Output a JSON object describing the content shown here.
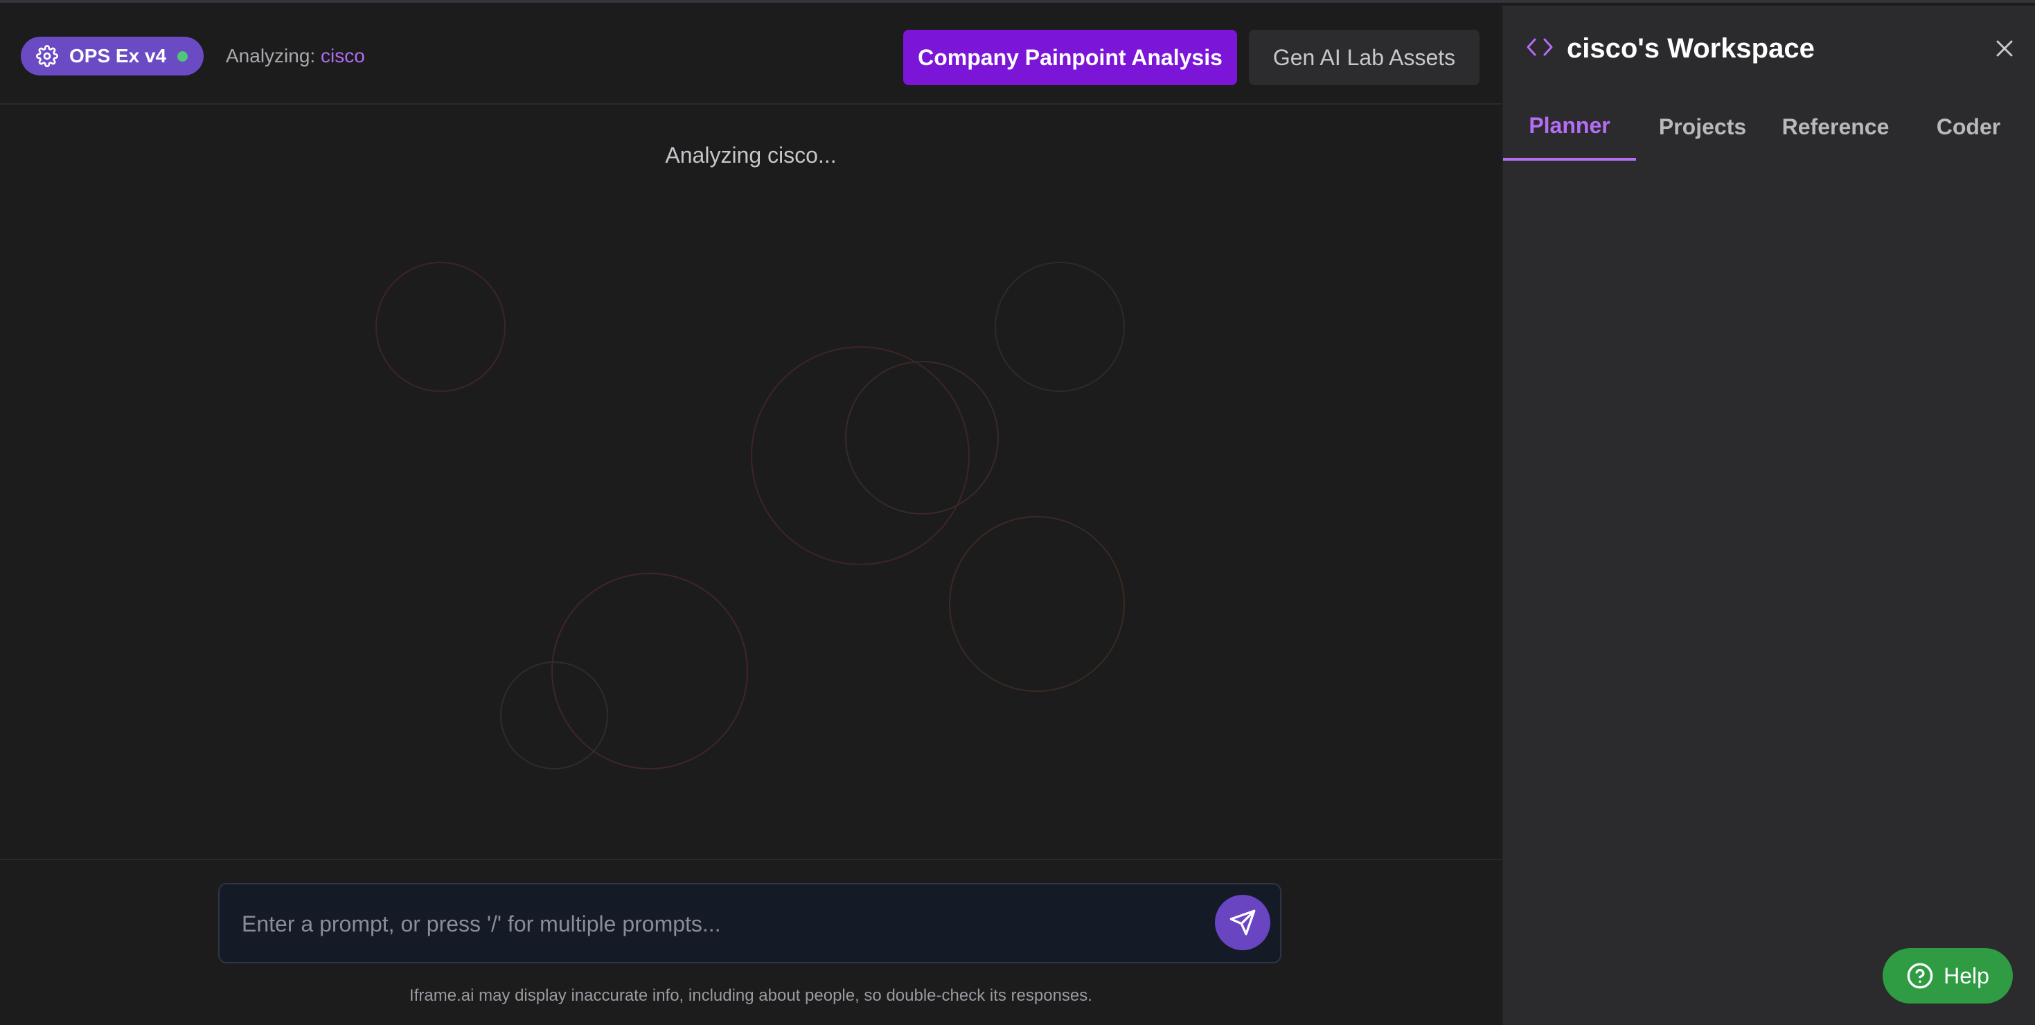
{
  "header": {
    "badge_label": "OPS Ex v4",
    "analyzing_prefix": "Analyzing:",
    "analyzing_company": "cisco",
    "primary_button": "Company Painpoint Analysis",
    "secondary_button": "Gen AI Lab Assets"
  },
  "main": {
    "status": "Analyzing cisco..."
  },
  "composer": {
    "placeholder": "Enter a prompt, or press '/' for multiple prompts...",
    "value": "",
    "disclaimer": "Iframe.ai may display inaccurate info, including about people, so double-check its responses."
  },
  "workspace": {
    "title": "cisco's Workspace",
    "tabs": [
      {
        "label": "Planner",
        "active": true
      },
      {
        "label": "Projects",
        "active": false
      },
      {
        "label": "Reference",
        "active": false
      },
      {
        "label": "Coder",
        "active": false
      }
    ]
  },
  "help": {
    "label": "Help"
  },
  "colors": {
    "accent": "#7b16d8",
    "badge": "#6a4bc4",
    "active_tab": "#b46ef5",
    "status_dot": "#4fc77a",
    "help": "#2f9c44"
  },
  "icons": {
    "badge": "gear-icon",
    "send": "send-icon",
    "workspace": "code-icon",
    "close": "close-icon",
    "help": "question-circle-icon"
  }
}
